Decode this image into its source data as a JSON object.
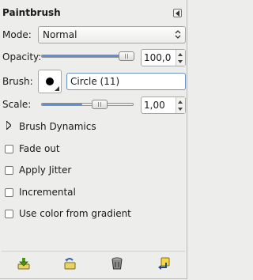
{
  "panel": {
    "title": "Paintbrush",
    "menu_icon": "triangle-left-icon"
  },
  "mode": {
    "label": "Mode:",
    "value": "Normal"
  },
  "opacity": {
    "label": "Opacity:",
    "value": "100,0",
    "fraction": 1.0
  },
  "brush": {
    "label": "Brush:",
    "name": "Circle (11)"
  },
  "scale": {
    "label": "Scale:",
    "value": "1,00",
    "fraction": 0.44
  },
  "dynamics": {
    "label": "Brush Dynamics"
  },
  "options": [
    {
      "label": "Fade out",
      "checked": false
    },
    {
      "label": "Apply Jitter",
      "checked": false
    },
    {
      "label": "Incremental",
      "checked": false
    },
    {
      "label": "Use color from gradient",
      "checked": false
    }
  ],
  "toolbar": {
    "buttons": [
      "save-options-icon",
      "restore-options-icon",
      "delete-options-icon",
      "reset-options-icon"
    ]
  },
  "colors": {
    "accent": "#5f8dd3",
    "background": "#ededeb"
  }
}
